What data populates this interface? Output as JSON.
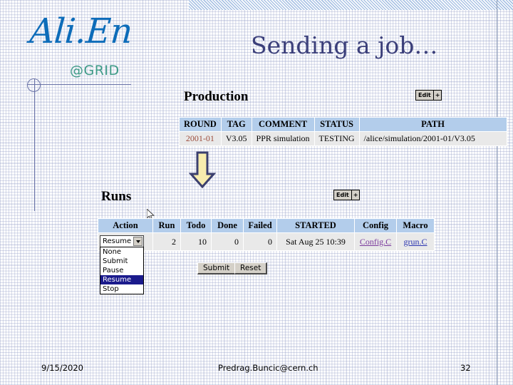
{
  "slide": {
    "title": "Sending a job…",
    "logo": {
      "brand": "Ali.En",
      "tagline": "@GRID",
      "brand_color": "#0d6cb9",
      "tagline_color": "#3d9a86"
    }
  },
  "production": {
    "heading": "Production",
    "edit_button": {
      "label": "Edit",
      "plus": "+"
    },
    "columns": [
      "ROUND",
      "TAG",
      "COMMENT",
      "STATUS",
      "PATH"
    ],
    "rows": [
      {
        "round": "2001-01",
        "tag": "V3.05",
        "comment": "PPR simulation",
        "status": "TESTING",
        "path": "/alice/simulation/2001-01/V3.05"
      }
    ]
  },
  "runs": {
    "heading": "Runs",
    "edit_button": {
      "label": "Edit",
      "plus": "+"
    },
    "columns": [
      "Action",
      "Run",
      "Todo",
      "Done",
      "Failed",
      "STARTED",
      "Config",
      "Macro"
    ],
    "rows": [
      {
        "action": "Resume",
        "run": "2",
        "todo": "10",
        "done": "0",
        "failed": "0",
        "started": "Sat Aug 25 10:39",
        "config": "Config.C",
        "macro": "grun.C"
      }
    ],
    "action_select": {
      "value": "Resume",
      "options": [
        "None",
        "Submit",
        "Pause",
        "Resume",
        "Stop"
      ],
      "selected_option": "Resume"
    },
    "form_buttons": {
      "submit": "Submit",
      "reset": "Reset"
    }
  },
  "arrow": {
    "direction": "down",
    "fill_color": "#f7ecae",
    "stroke_color": "#3b3f6e"
  },
  "footer": {
    "date": "9/15/2020",
    "email": "Predrag.Buncic@cern.ch",
    "page_number": "32"
  }
}
